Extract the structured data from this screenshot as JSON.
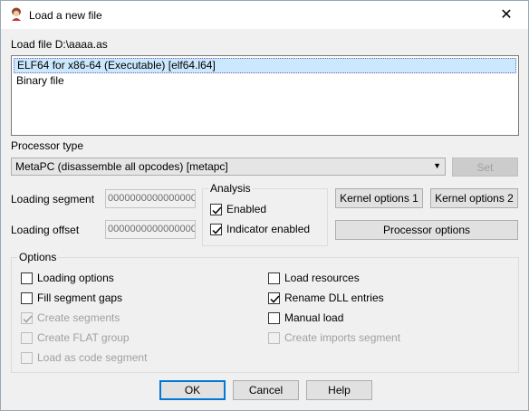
{
  "window": {
    "title": "Load a new file",
    "close_glyph": "✕",
    "icon": "app-icon"
  },
  "load_file_label": "Load file D:\\aaaa.as",
  "file_types": [
    {
      "label": "ELF64 for x86-64 (Executable) [elf64.l64]",
      "selected": true
    },
    {
      "label": "Binary file",
      "selected": false
    }
  ],
  "processor_type_label": "Processor type",
  "processor": {
    "value": "MetaPC (disassemble all opcodes) [metapc]",
    "set_label": "Set"
  },
  "loading_segment": {
    "label": "Loading segment",
    "value": "0000000000000000"
  },
  "loading_offset": {
    "label": "Loading offset",
    "value": "0000000000000000"
  },
  "analysis": {
    "legend": "Analysis",
    "enabled": {
      "label": "Enabled",
      "checked": true
    },
    "indicator": {
      "label": "Indicator enabled",
      "checked": true
    }
  },
  "kernel_options_1": "Kernel options 1",
  "kernel_options_2": "Kernel options 2",
  "processor_options": "Processor options",
  "options": {
    "legend": "Options",
    "left": [
      {
        "label": "Loading options",
        "checked": false,
        "disabled": false
      },
      {
        "label": "Fill segment gaps",
        "checked": false,
        "disabled": false
      },
      {
        "label": "Create segments",
        "checked": true,
        "disabled": true
      },
      {
        "label": "Create FLAT group",
        "checked": false,
        "disabled": true
      },
      {
        "label": "Load as code segment",
        "checked": false,
        "disabled": true
      }
    ],
    "right": [
      {
        "label": "Load resources",
        "checked": false,
        "disabled": false
      },
      {
        "label": "Rename DLL entries",
        "checked": true,
        "disabled": false
      },
      {
        "label": "Manual load",
        "checked": false,
        "disabled": false
      },
      {
        "label": "Create imports segment",
        "checked": false,
        "disabled": true
      }
    ]
  },
  "buttons": {
    "ok": "OK",
    "cancel": "Cancel",
    "help": "Help"
  }
}
